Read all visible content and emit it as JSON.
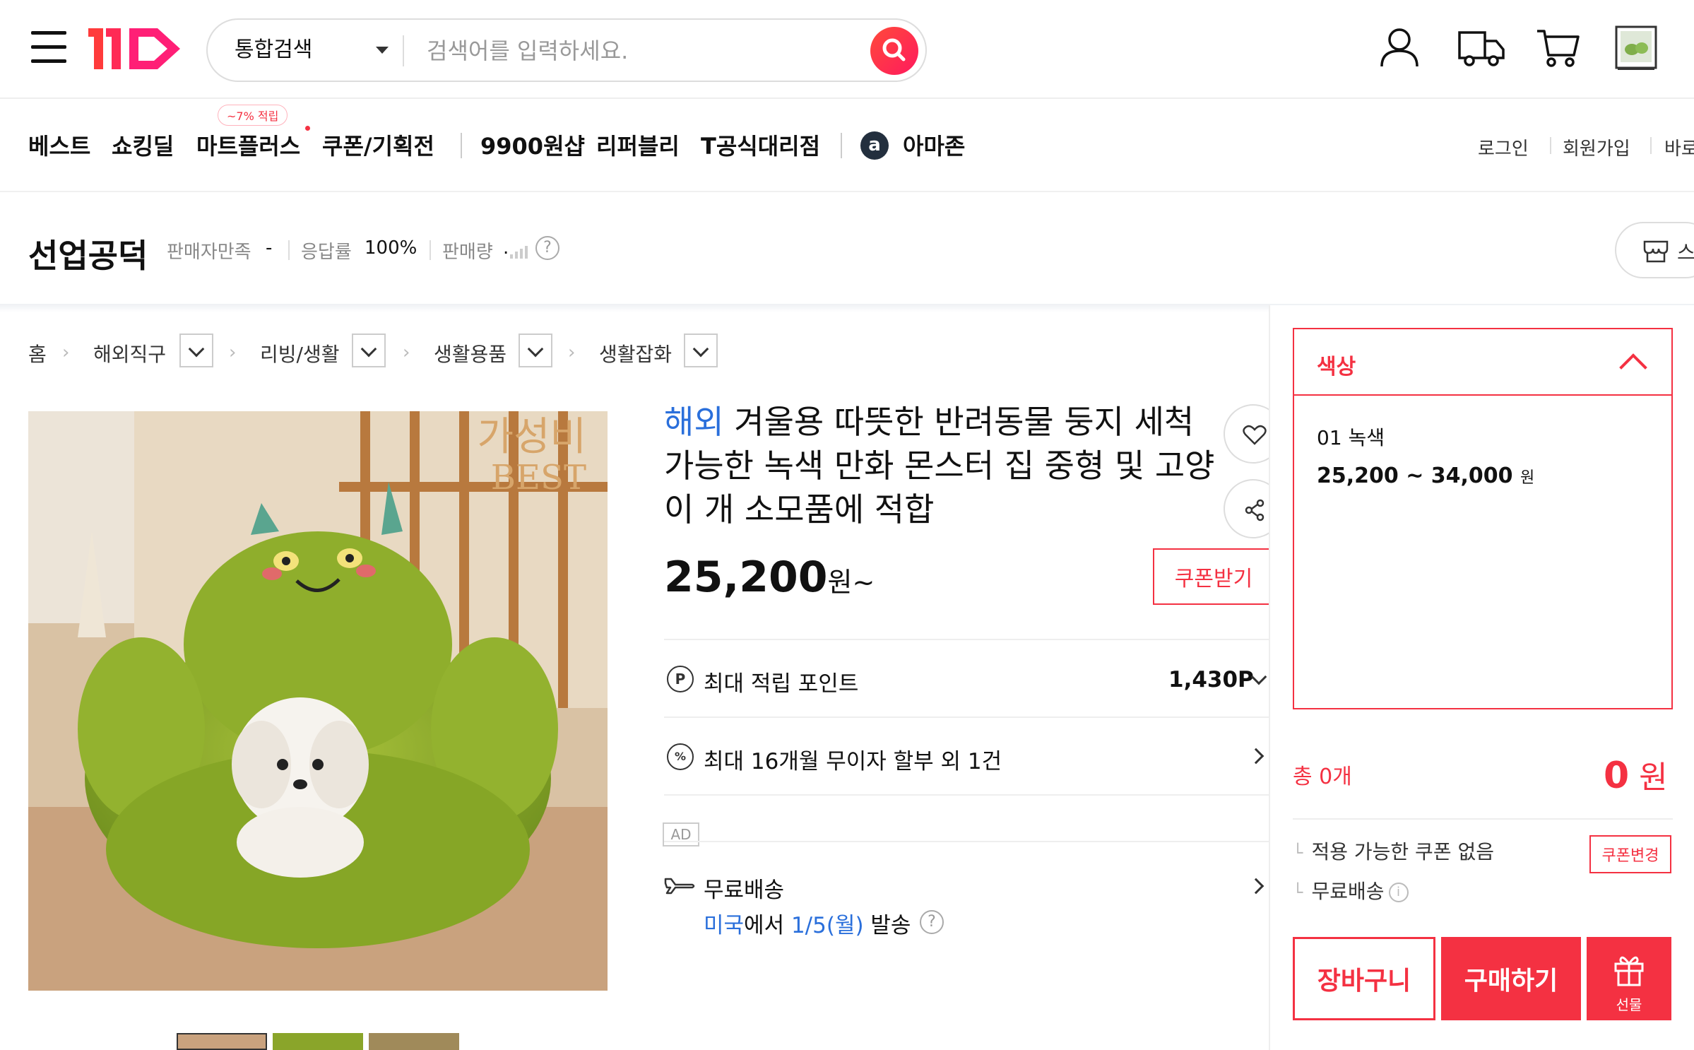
{
  "header": {
    "search_scope": "통합검색",
    "search_placeholder": "검색어를 입력하세요."
  },
  "nav": {
    "items": [
      "베스트",
      "쇼킹딜",
      "마트플러스",
      "쿠폰/기획전",
      "9900원샵",
      "리퍼블리",
      "T공식대리점",
      "아마존"
    ],
    "badge": "~7% 적립",
    "amazon_letter": "a",
    "util_links": [
      "로그인",
      "회원가입",
      "바로"
    ]
  },
  "seller": {
    "name": "선업공덕",
    "satisfaction_label": "판매자만족",
    "satisfaction_value": "-",
    "response_label": "응답률",
    "response_value": "100%",
    "sales_label": "판매량",
    "sales_value": ".",
    "store_label": "스"
  },
  "breadcrumb": [
    "홈",
    "해외직구",
    "리빙/생활",
    "생활용품",
    "생활잡화"
  ],
  "product": {
    "title_prefix": "해외",
    "title": "겨울용 따뜻한 반려동물 둥지 세척 가능한 녹색 만화 몬스터 집 중형 및 고양이 개 소모품에 적합",
    "image_overlay_line1": "가성비",
    "image_overlay_line2": "BEST",
    "price": "25,200",
    "price_suffix": "원~",
    "coupon_button": "쿠폰받기",
    "points_label": "최대 적립 포인트",
    "points_value": "1,430P",
    "installment_label": "최대 16개월 무이자 할부 외 1건",
    "ad_label": "AD",
    "shipping_label": "무료배송",
    "shipping_origin": "미국",
    "shipping_mid": "에서 ",
    "shipping_date": "1/5(월)",
    "shipping_end": " 발송"
  },
  "options": {
    "title": "색상",
    "item_name": "01 녹색",
    "item_price": "25,200 ~ 34,000",
    "item_price_unit": "원"
  },
  "order": {
    "total_label": "총 0개",
    "total_price": "0",
    "total_unit": " 원",
    "coupon_note": "적용 가능한 쿠폰 없음",
    "coupon_change": "쿠폰변경",
    "shipping_note": "무료배송",
    "cart_button": "장바구니",
    "buy_button": "구매하기",
    "gift_button": "선물"
  },
  "colors": {
    "accent": "#f43142",
    "link_blue": "#2a6fdb"
  },
  "icons": [
    "menu-icon",
    "search-icon",
    "user-icon",
    "delivery-truck-icon",
    "cart-icon",
    "recent-product-icon",
    "heart-icon",
    "share-icon",
    "point-icon",
    "percent-icon",
    "plane-icon",
    "gift-icon",
    "help-icon",
    "store-icon"
  ]
}
